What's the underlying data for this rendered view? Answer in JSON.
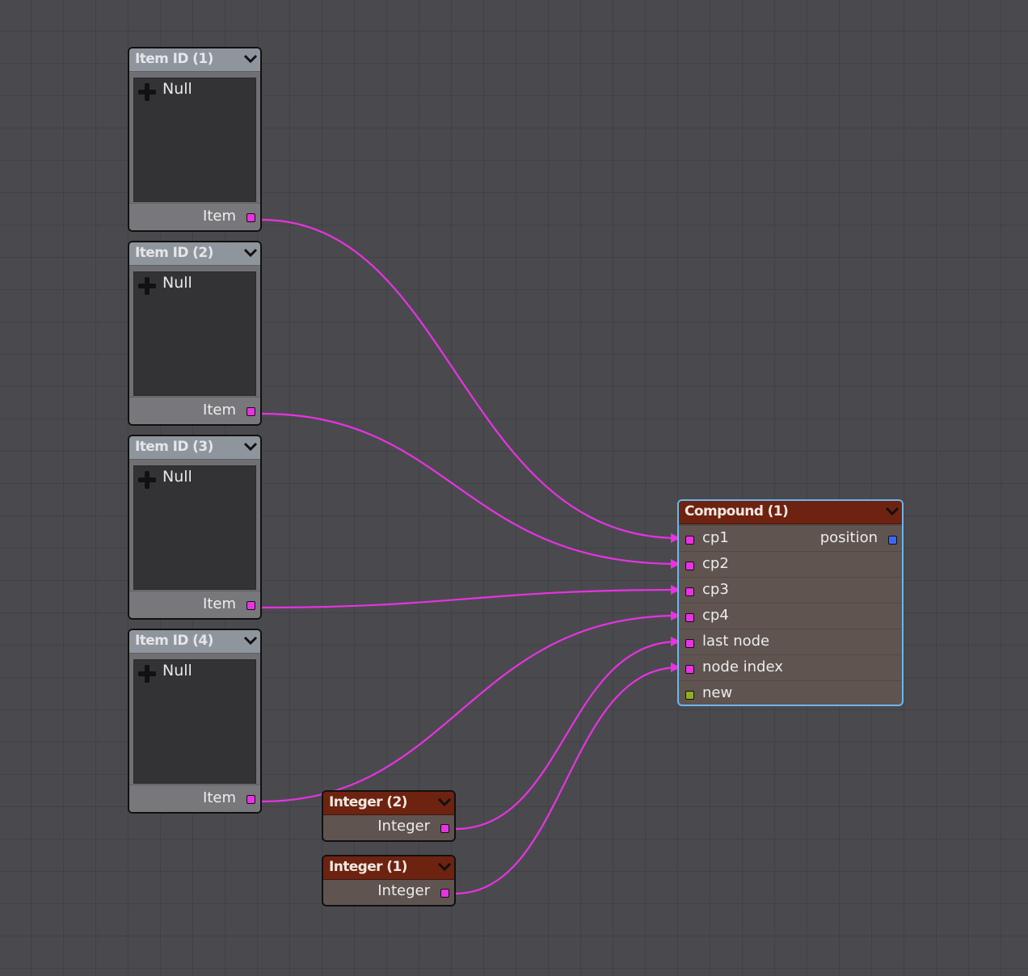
{
  "wire_color": "#e832e3",
  "item_nodes": [
    {
      "title": "Item ID (1)",
      "list_entry": "Null",
      "output": "Item"
    },
    {
      "title": "Item ID (2)",
      "list_entry": "Null",
      "output": "Item"
    },
    {
      "title": "Item ID (3)",
      "list_entry": "Null",
      "output": "Item"
    },
    {
      "title": "Item ID (4)",
      "list_entry": "Null",
      "output": "Item"
    }
  ],
  "compound": {
    "title": "Compound (1)",
    "inputs": [
      "cp1",
      "cp2",
      "cp3",
      "cp4",
      "last node",
      "node index",
      "new"
    ],
    "output": "position"
  },
  "integer_nodes": [
    {
      "title": "Integer (2)",
      "output": "Integer"
    },
    {
      "title": "Integer (1)",
      "output": "Integer"
    }
  ],
  "port_colors": {
    "item": "#e832e3",
    "integer": "#e832e3",
    "position": "#3d66f2",
    "new": "#8fae24"
  },
  "node_colors": {
    "item_header": "#8f959c",
    "compound_header": "#6e2210",
    "compound_border": "#6cb6ee"
  }
}
